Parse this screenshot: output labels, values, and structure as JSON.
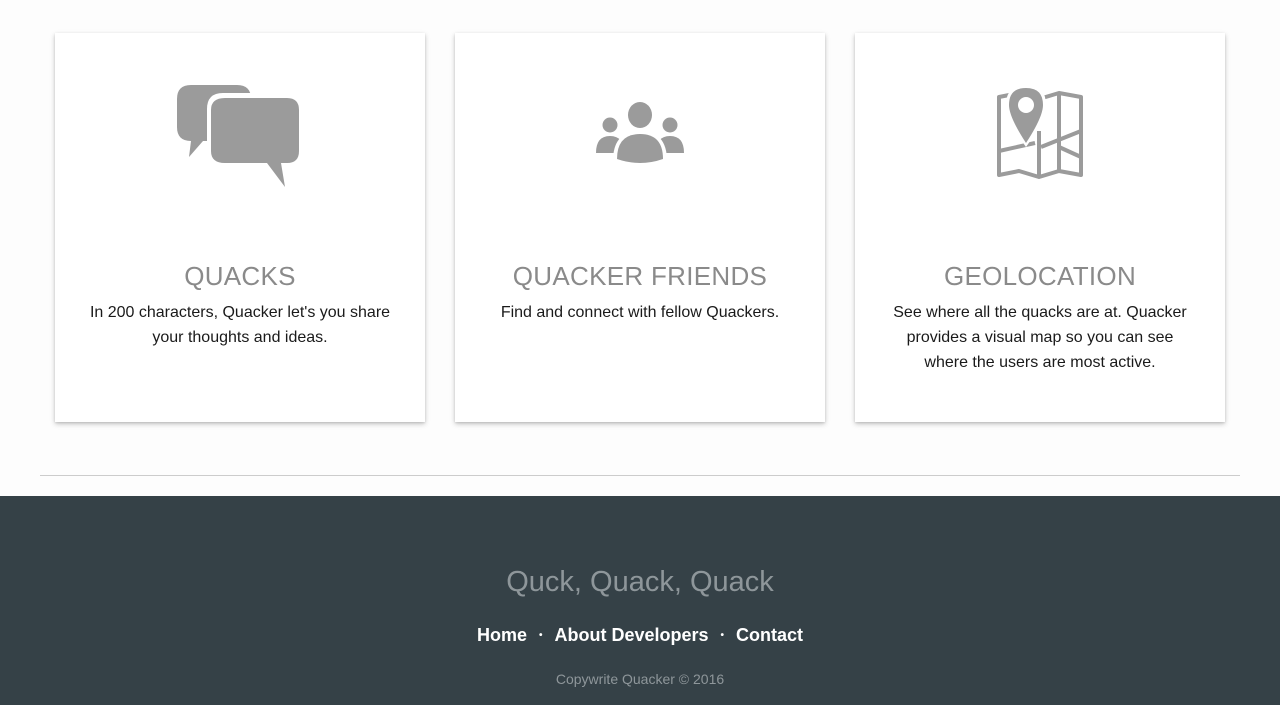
{
  "features": [
    {
      "icon": "speech-bubbles-icon",
      "title": "QUACKS",
      "description": "In 200 characters, Quacker let's you share your thoughts and ideas."
    },
    {
      "icon": "users-group-icon",
      "title": "QUACKER FRIENDS",
      "description": "Find and connect with fellow Quackers."
    },
    {
      "icon": "map-pin-icon",
      "title": "GEOLOCATION",
      "description": "See where all the quacks are at. Quacker provides a visual map so you can see where the users are most active."
    }
  ],
  "footer": {
    "title": "Quck, Quack, Quack",
    "nav": [
      {
        "label": "Home"
      },
      {
        "label": "About Developers"
      },
      {
        "label": "Contact"
      }
    ],
    "separator": "•",
    "copyright": "Copywrite Quacker © 2016"
  },
  "colors": {
    "icon": "#9b9b9b",
    "card_title": "#8a8a8a",
    "footer_bg": "#354147",
    "footer_muted": "#8e969a"
  }
}
